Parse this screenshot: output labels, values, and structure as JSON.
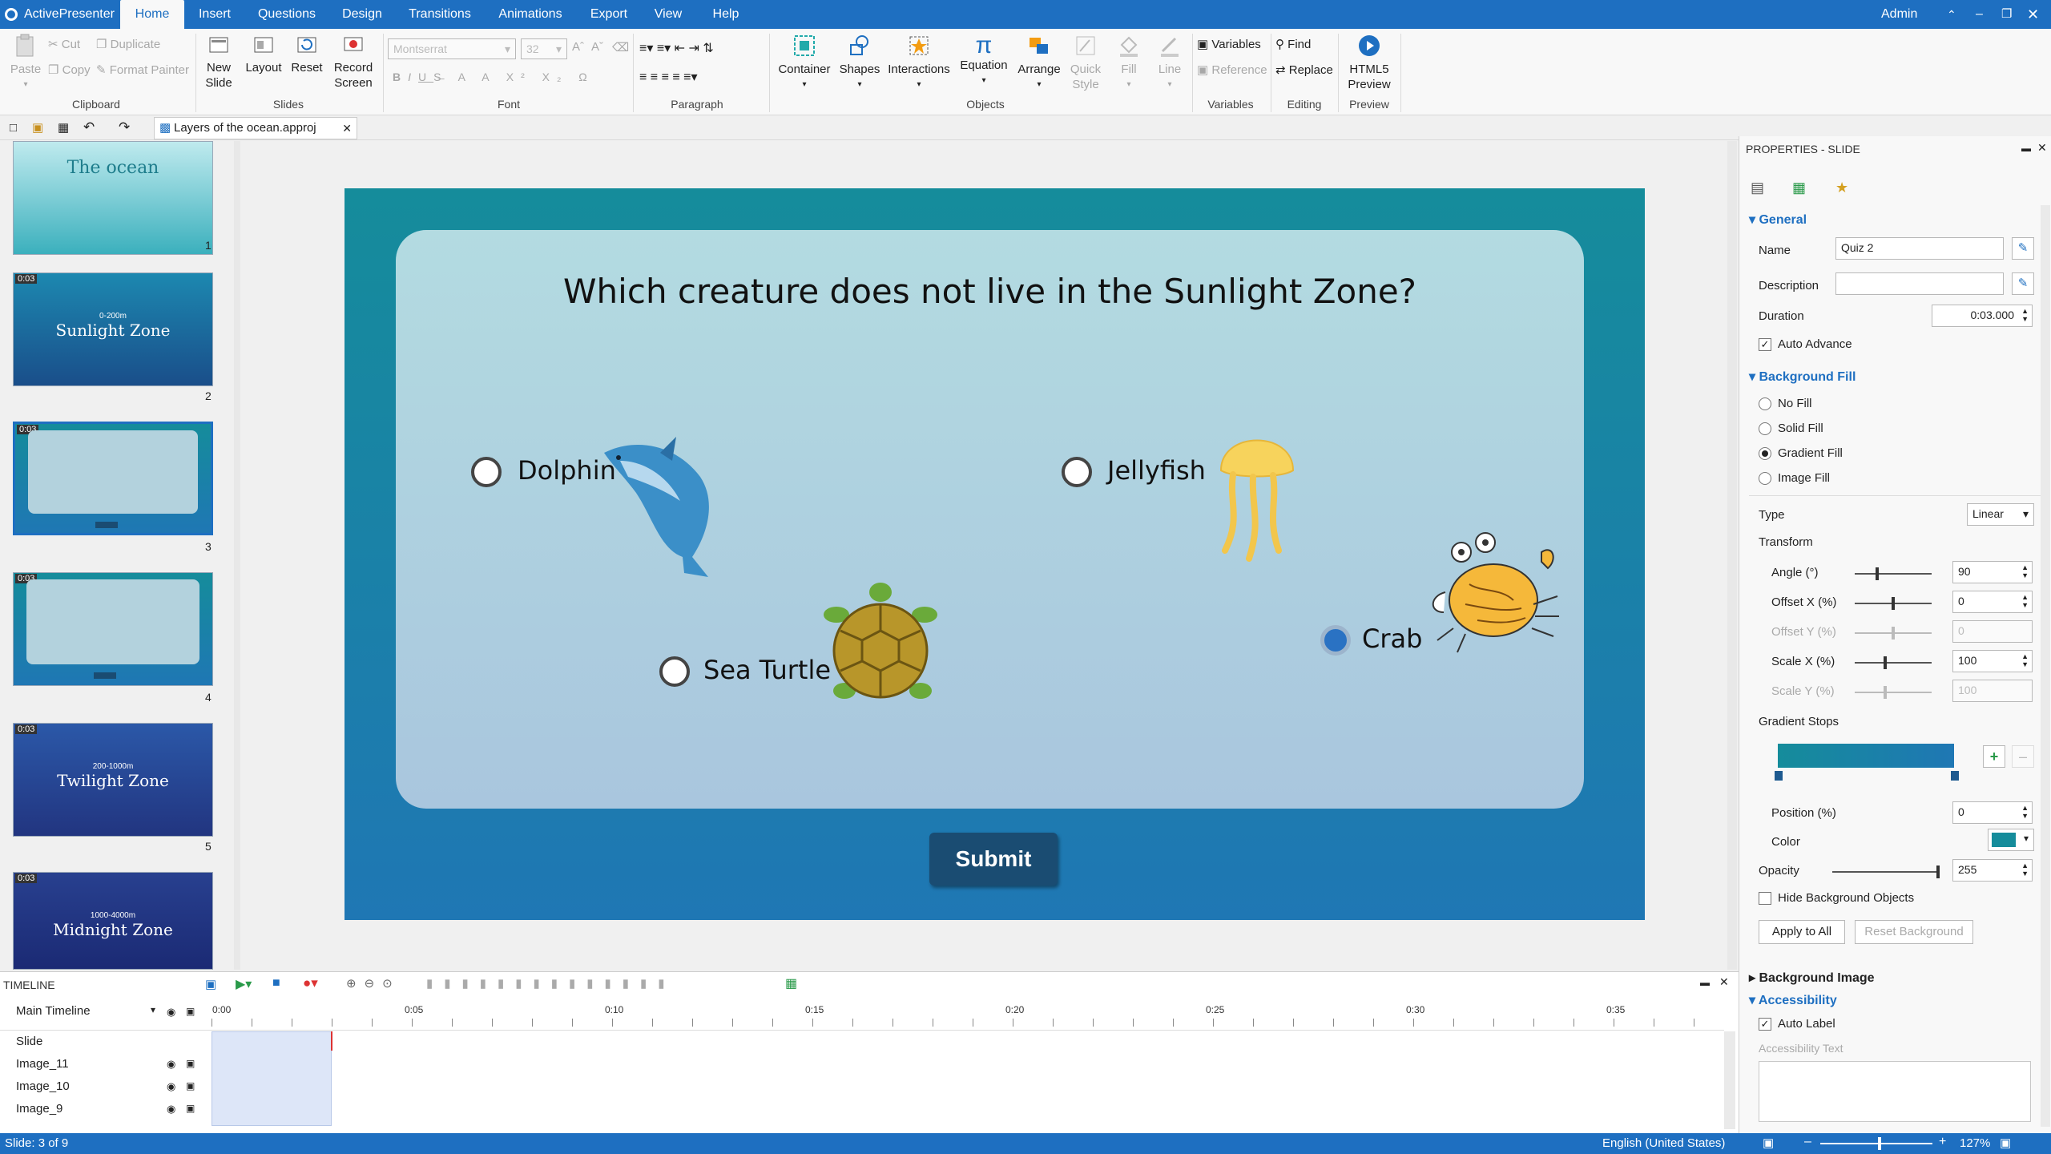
{
  "app": {
    "name": "ActivePresenter",
    "user": "Admin"
  },
  "menu": {
    "tabs": [
      "Home",
      "Insert",
      "Questions",
      "Design",
      "Transitions",
      "Animations",
      "Export",
      "View",
      "Help"
    ],
    "active": "Home"
  },
  "ribbon": {
    "clipboard": {
      "paste": "Paste",
      "cut": "Cut",
      "copy": "Copy",
      "duplicate": "Duplicate",
      "format_painter": "Format Painter",
      "label": "Clipboard"
    },
    "slides": {
      "new_slide": "New Slide",
      "layout": "Layout",
      "reset": "Reset",
      "record_screen": "Record Screen",
      "label": "Slides"
    },
    "font": {
      "family": "Montserrat",
      "size": "32",
      "label": "Font"
    },
    "paragraph": {
      "label": "Paragraph"
    },
    "objects": {
      "container": "Container",
      "shapes": "Shapes",
      "interactions": "Interactions",
      "equation": "Equation",
      "arrange": "Arrange",
      "quick_style": "Quick Style",
      "fill": "Fill",
      "line": "Line",
      "label": "Objects"
    },
    "variables": {
      "variables": "Variables",
      "reference": "Reference",
      "label": "Variables"
    },
    "editing": {
      "find": "Find",
      "replace": "Replace",
      "label": "Editing"
    },
    "preview": {
      "html5": "HTML5 Preview",
      "label": "Preview"
    }
  },
  "doc": {
    "tab_name": "Layers of the ocean.approj"
  },
  "thumbnails": [
    {
      "num": "1",
      "duration": "",
      "title": "The ocean",
      "bg": "#5ec4cc"
    },
    {
      "num": "2",
      "duration": "0:03",
      "title": "Sunlight Zone",
      "sub": "0-200m",
      "bg": "#1a6aa0"
    },
    {
      "num": "3",
      "duration": "0:03",
      "title": "",
      "bg": "#1a82b0"
    },
    {
      "num": "4",
      "duration": "0:03",
      "title": "",
      "bg": "#1a82b0"
    },
    {
      "num": "5",
      "duration": "0:03",
      "title": "Twilight Zone",
      "sub": "200-1000m",
      "bg": "#25428f"
    },
    {
      "num": "",
      "duration": "0:03",
      "title": "Midnight Zone",
      "sub": "1000-4000m",
      "bg": "#1c2c78"
    }
  ],
  "slide": {
    "question": "Which creature does not live in the Sunlight Zone?",
    "options": [
      {
        "label": "Dolphin",
        "checked": false
      },
      {
        "label": "Jellyfish",
        "checked": false
      },
      {
        "label": "Sea Turtle",
        "checked": false
      },
      {
        "label": "Crab",
        "checked": true
      }
    ],
    "submit": "Submit"
  },
  "properties": {
    "title": "PROPERTIES - SLIDE",
    "general": {
      "header": "General",
      "name_label": "Name",
      "name_value": "Quiz 2",
      "description_label": "Description",
      "description_value": "",
      "duration_label": "Duration",
      "duration_value": "0:03.000",
      "auto_advance": "Auto Advance",
      "auto_advance_checked": true
    },
    "background_fill": {
      "header": "Background Fill",
      "options": [
        "No Fill",
        "Solid Fill",
        "Gradient Fill",
        "Image Fill"
      ],
      "selected": "Gradient Fill",
      "type_label": "Type",
      "type_value": "Linear",
      "transform": "Transform",
      "angle_label": "Angle (°)",
      "angle_value": "90",
      "offset_x_label": "Offset X (%)",
      "offset_x_value": "0",
      "offset_y_label": "Offset Y (%)",
      "offset_y_value": "0",
      "scale_x_label": "Scale X (%)",
      "scale_x_value": "100",
      "scale_y_label": "Scale Y (%)",
      "scale_y_value": "100",
      "gradient_stops": "Gradient Stops",
      "position_label": "Position (%)",
      "position_value": "0",
      "color_label": "Color",
      "color_value": "#158c9b",
      "opacity_label": "Opacity",
      "opacity_value": "255",
      "hide_bg_objects": "Hide Background Objects",
      "apply_to_all": "Apply to All",
      "reset_background": "Reset Background"
    },
    "background_image": {
      "header": "Background Image"
    },
    "accessibility": {
      "header": "Accessibility",
      "auto_label": "Auto Label",
      "auto_label_checked": true,
      "text_label": "Accessibility Text"
    }
  },
  "timeline": {
    "title": "TIMELINE",
    "main": "Main Timeline",
    "ticks": [
      "0:00",
      "0:05",
      "0:10",
      "0:15",
      "0:20",
      "0:25",
      "0:30",
      "0:35"
    ],
    "rows": [
      "Slide",
      "Image_11",
      "Image_10",
      "Image_9"
    ]
  },
  "status": {
    "slide": "Slide: 3 of 9",
    "language": "English (United States)",
    "zoom": "127%"
  },
  "colors": {
    "accent": "#1e6fc1",
    "submit": "#1a4c72",
    "selected_radio": "#2a72c3"
  }
}
